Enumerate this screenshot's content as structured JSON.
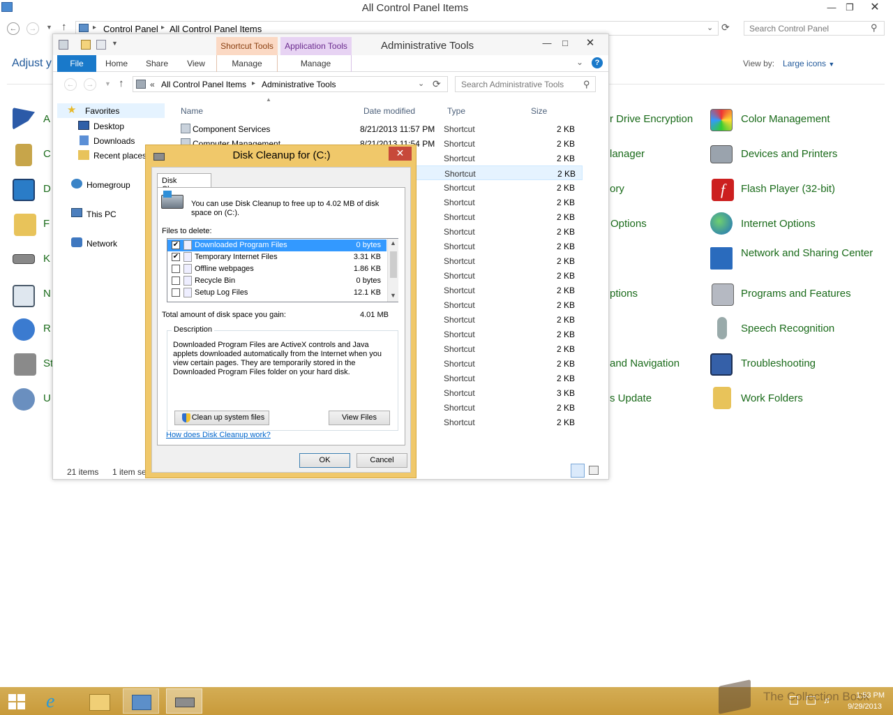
{
  "control_panel": {
    "title": "All Control Panel Items",
    "breadcrumbs": [
      "Control Panel",
      "All Control Panel Items"
    ],
    "search_placeholder": "Search Control Panel",
    "heading": "Adjust y",
    "view_by_label": "View by:",
    "view_by_value": "Large icons",
    "left_items_partial": [
      "A",
      "C",
      "D",
      "F",
      "K",
      "N",
      "R",
      "St",
      "U"
    ],
    "middle_items_partial": [
      "r Drive Encryption",
      "lanager",
      "ory",
      "Options",
      "ptions",
      "and Navigation",
      "s Update"
    ],
    "right_items": [
      "Color Management",
      "Devices and Printers",
      "Flash Player (32-bit)",
      "Internet Options",
      "Network and Sharing Center",
      "Programs and Features",
      "Speech Recognition",
      "Troubleshooting",
      "Work Folders"
    ]
  },
  "admin_tools": {
    "title": "Administrative Tools",
    "context_tabs": [
      "Shortcut Tools",
      "Application Tools"
    ],
    "ribbon_tabs": [
      "File",
      "Home",
      "Share",
      "View",
      "Manage",
      "Manage"
    ],
    "address_prefix": "«",
    "breadcrumbs": [
      "All Control Panel Items",
      "Administrative Tools"
    ],
    "search_placeholder": "Search Administrative Tools",
    "nav": {
      "favorites": "Favorites",
      "desktop": "Desktop",
      "downloads": "Downloads",
      "recent": "Recent places",
      "homegroup": "Homegroup",
      "thispc": "This PC",
      "network": "Network"
    },
    "columns": [
      "Name",
      "Date modified",
      "Type",
      "Size"
    ],
    "files": [
      {
        "name": "Component Services",
        "date": "8/21/2013 11:57 PM",
        "type": "Shortcut",
        "size": "2 KB"
      },
      {
        "name": "Computer Management",
        "date": "8/21/2013 11:54 PM",
        "type": "Shortcut",
        "size": "2 KB"
      },
      {
        "name": "",
        "date": "7 PM",
        "type": "Shortcut",
        "size": "2 KB"
      },
      {
        "name": "",
        "date": "7 PM",
        "type": "Shortcut",
        "size": "2 KB"
      },
      {
        "name": "",
        "date": "5 PM",
        "type": "Shortcut",
        "size": "2 KB"
      },
      {
        "name": "",
        "date": "7 PM",
        "type": "Shortcut",
        "size": "2 KB"
      },
      {
        "name": "",
        "date": "4 PM",
        "type": "Shortcut",
        "size": "2 KB"
      },
      {
        "name": "",
        "date": "PM",
        "type": "Shortcut",
        "size": "2 KB"
      },
      {
        "name": "",
        "date": "9 PM",
        "type": "Shortcut",
        "size": "2 KB"
      },
      {
        "name": "",
        "date": "2 PM",
        "type": "Shortcut",
        "size": "2 KB"
      },
      {
        "name": "",
        "date": "4 PM",
        "type": "Shortcut",
        "size": "2 KB"
      },
      {
        "name": "",
        "date": "2 PM",
        "type": "Shortcut",
        "size": "2 KB"
      },
      {
        "name": "",
        "date": "4 PM",
        "type": "Shortcut",
        "size": "2 KB"
      },
      {
        "name": "",
        "date": "3 PM",
        "type": "Shortcut",
        "size": "2 KB"
      },
      {
        "name": "",
        "date": "3 PM",
        "type": "Shortcut",
        "size": "2 KB"
      },
      {
        "name": "",
        "date": "5 PM",
        "type": "Shortcut",
        "size": "2 KB"
      },
      {
        "name": "",
        "date": "5 PM",
        "type": "Shortcut",
        "size": "2 KB"
      },
      {
        "name": "",
        "date": "2 PM",
        "type": "Shortcut",
        "size": "2 KB"
      },
      {
        "name": "",
        "date": "AM",
        "type": "Shortcut",
        "size": "3 KB"
      },
      {
        "name": "",
        "date": "5 PM",
        "type": "Shortcut",
        "size": "2 KB"
      },
      {
        "name": "",
        "date": "5 PM",
        "type": "Shortcut",
        "size": "2 KB"
      }
    ],
    "status_items": "21 items",
    "status_selected": "1 item se"
  },
  "disk_cleanup": {
    "title": "Disk Cleanup for  (C:)",
    "tab": "Disk Cleanup",
    "intro": "You can use Disk Cleanup to free up to 4.02 MB of disk space on  (C:).",
    "files_label": "Files to delete:",
    "items": [
      {
        "name": "Downloaded Program Files",
        "size": "0 bytes",
        "checked": true,
        "selected": true
      },
      {
        "name": "Temporary Internet Files",
        "size": "3.31 KB",
        "checked": true,
        "selected": false
      },
      {
        "name": "Offline webpages",
        "size": "1.86 KB",
        "checked": false,
        "selected": false
      },
      {
        "name": "Recycle Bin",
        "size": "0 bytes",
        "checked": false,
        "selected": false
      },
      {
        "name": "Setup Log Files",
        "size": "12.1 KB",
        "checked": false,
        "selected": false
      }
    ],
    "total_label": "Total amount of disk space you gain:",
    "total_value": "4.01 MB",
    "description_label": "Description",
    "description": "Downloaded Program Files are ActiveX controls and Java applets downloaded automatically from the Internet when you view certain pages. They are temporarily stored in the Downloaded Program Files folder on your hard disk.",
    "cleanup_system_label": "Clean up system files",
    "view_files_label": "View Files",
    "help_link": "How does Disk Cleanup work?",
    "ok_label": "OK",
    "cancel_label": "Cancel"
  },
  "taskbar": {
    "time": "1:53 PM",
    "date": "9/29/2013",
    "watermark": "The Collection Book"
  }
}
